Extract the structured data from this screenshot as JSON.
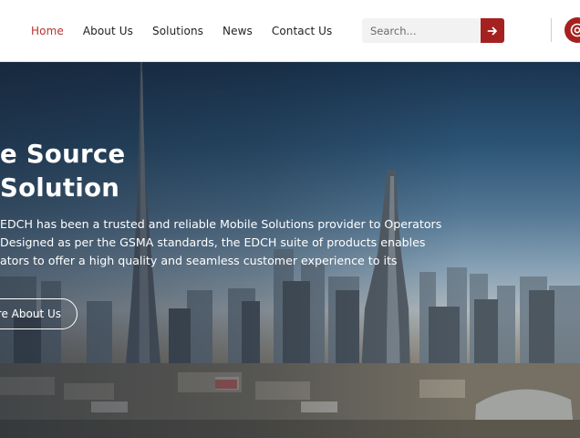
{
  "nav": {
    "items": [
      {
        "label": "Home",
        "active": true
      },
      {
        "label": "About Us",
        "active": false
      },
      {
        "label": "Solutions",
        "active": false
      },
      {
        "label": "News",
        "active": false
      },
      {
        "label": "Contact Us",
        "active": false
      }
    ]
  },
  "search": {
    "placeholder": "Search..."
  },
  "icons": {
    "search_submit": "arrow-right-icon",
    "contact": "at-sign-icon"
  },
  "colors": {
    "accent": "#b7312c",
    "button": "#a5211f",
    "hero_text": "#ffffff"
  },
  "hero": {
    "title_lines": [
      "e Source",
      "Solution"
    ],
    "text_lines": [
      "EDCH has been a trusted and reliable Mobile Solutions provider to Operators",
      "Designed as per the GSMA standards, the EDCH suite of products enables",
      "ators to offer a high quality and seamless customer experience to its"
    ],
    "button_label": "re About Us"
  }
}
